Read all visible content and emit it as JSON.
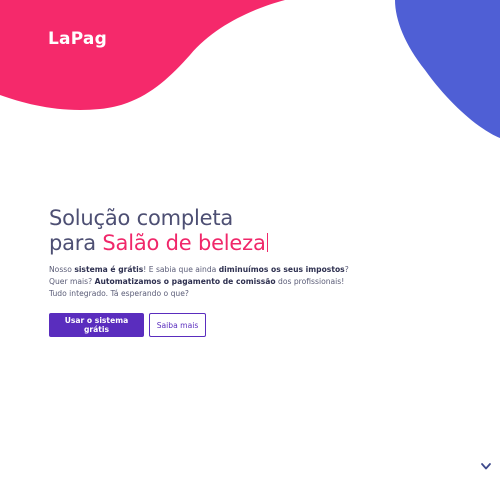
{
  "brand": {
    "logo_text": "LaPag",
    "pink": "#f5296b",
    "blue": "#4f5fd5",
    "purple": "#5a2dbe",
    "heading_color": "#4d4f73"
  },
  "hero": {
    "headline_line1": "Solução completa",
    "headline_line2_prefix": "para ",
    "headline_accent": "Salão de beleza",
    "desc": {
      "l1_a": "Nosso ",
      "l1_b": "sistema é grátis",
      "l1_c": "! E sabia que ainda ",
      "l1_d": "diminuímos os seus impostos",
      "l1_e": "?",
      "l2_a": "Quer mais? ",
      "l2_b": "Automatizamos o pagamento de comissão",
      "l2_c": " dos profissionais!",
      "l3": "Tudo integrado. Tá esperando o que?"
    },
    "primary_button": "Usar o sistema grátis",
    "secondary_button": "Saiba mais"
  },
  "icons": {
    "scroll": "chevron-down-icon"
  }
}
